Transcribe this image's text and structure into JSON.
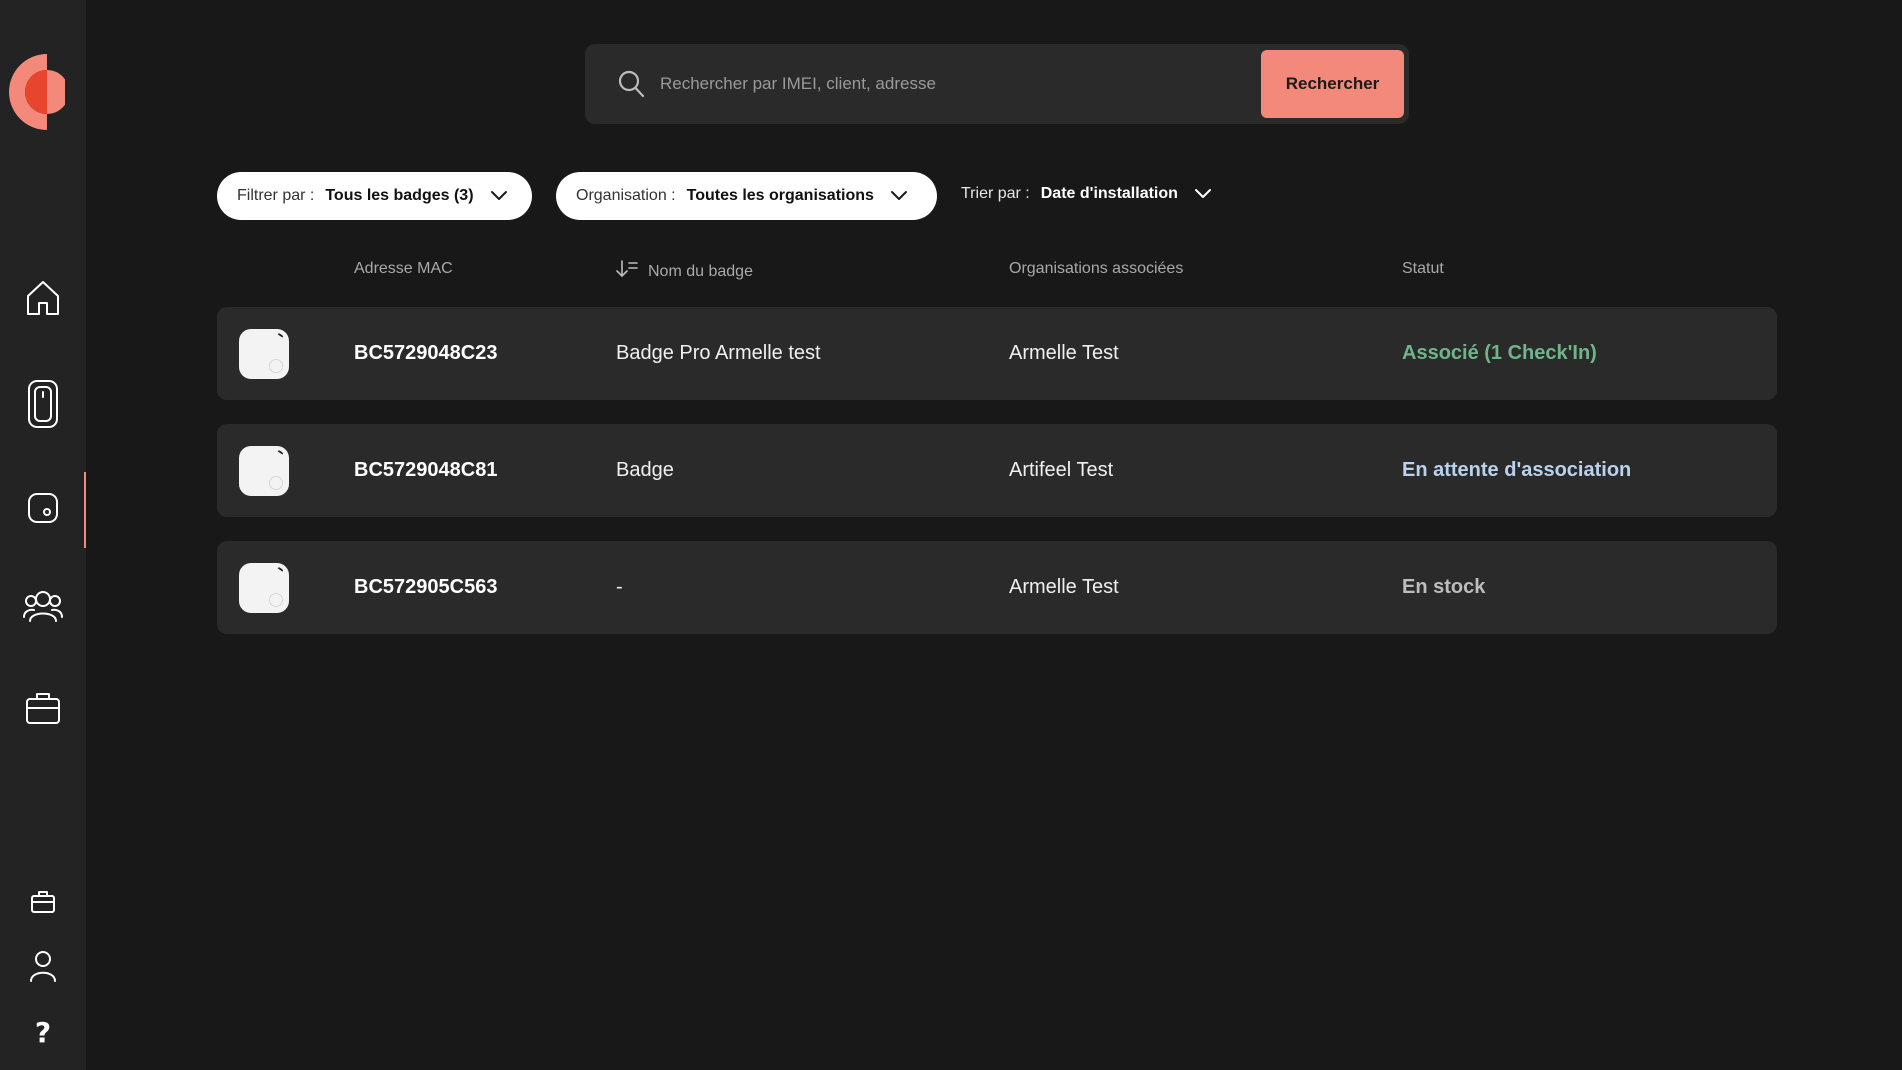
{
  "search": {
    "placeholder": "Rechercher par IMEI, client, adresse",
    "button_label": "Rechercher"
  },
  "filters": {
    "filter": {
      "label": "Filtrer par :",
      "value": "Tous les badges (3)"
    },
    "organisation": {
      "label": "Organisation :",
      "value": "Toutes les organisations"
    },
    "sort": {
      "label": "Trier par :",
      "value": "Date d'installation"
    }
  },
  "table": {
    "columns": [
      "Adresse MAC",
      "Nom du badge",
      "Organisations associées",
      "Statut"
    ],
    "rows": [
      {
        "mac": "BC5729048C23",
        "name": "Badge Pro Armelle test",
        "organisation": "Armelle Test",
        "status": "Associé (1 Check'In)",
        "status_color": "#6fb58a"
      },
      {
        "mac": "BC5729048C81",
        "name": "Badge",
        "organisation": "Artifeel Test",
        "status": "En attente d'association",
        "status_color": "#b9d2ee"
      },
      {
        "mac": "BC572905C563",
        "name": "-",
        "organisation": "Armelle Test",
        "status": "En stock",
        "status_color": "#bdbdbd"
      }
    ]
  },
  "sidebar": {
    "items": [
      {
        "icon": "home-icon"
      },
      {
        "icon": "phone-icon"
      },
      {
        "icon": "badge-icon",
        "active": true
      },
      {
        "icon": "users-icon"
      },
      {
        "icon": "briefcase-icon"
      },
      {
        "icon": "briefcase-small-icon"
      },
      {
        "icon": "user-icon"
      },
      {
        "icon": "help-icon",
        "glyph": "?"
      }
    ]
  },
  "colors": {
    "accent": "#f2897b",
    "background": "#181818",
    "sidebar": "#232323",
    "row": "#2a2a2a"
  }
}
